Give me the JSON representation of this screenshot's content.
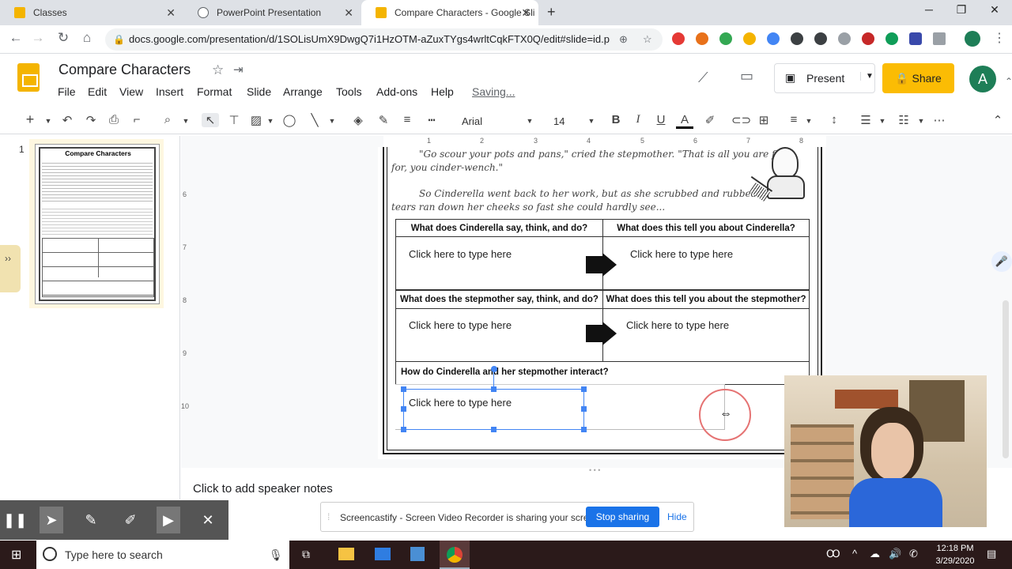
{
  "browser": {
    "tabs": [
      {
        "label": "Classes",
        "color": "#f4b400"
      },
      {
        "label": "PowerPoint Presentation",
        "color": "#5f6368"
      },
      {
        "label": "Compare Characters - Google Sli",
        "color": "#f4b400"
      }
    ],
    "url": "docs.google.com/presentation/d/1SOLisUmX9DwgQ7i1HzOTM-aZuxTYgs4wrltCqkFTX0Q/edit#slide=id.p"
  },
  "header": {
    "title": "Compare Characters",
    "menu": [
      "File",
      "Edit",
      "View",
      "Insert",
      "Format",
      "Slide",
      "Arrange",
      "Tools",
      "Add-ons",
      "Help"
    ],
    "status": "Saving...",
    "present_label": "Present",
    "share_label": "Share",
    "avatar_letter": "A",
    "accent_color": "#fbbc04"
  },
  "toolbar": {
    "font": "Arial",
    "font_size": "14"
  },
  "filmstrip": {
    "slide_number": "1",
    "thumb_title": "Compare Characters"
  },
  "slide": {
    "story_line1": "\"Go scour your pots and pans,\" cried the stepmother. \"That is all you are fit",
    "story_line2": "for, you cinder-wench.\"",
    "story_line3": "So Cinderella went back to her work, but as she scrubbed and rubbed the",
    "story_line4": "tears ran down her cheeks so fast she could hardly see...",
    "q1_left": "What does Cinderella say, think, and do?",
    "q1_right": "What does this tell you about Cinderella?",
    "q2_left": "What does the stepmother say, think, and do?",
    "q2_right": "What does this tell you about the stepmother?",
    "q3": "How do Cinderella and her stepmother interact?",
    "placeholder": "Click here to type here"
  },
  "ruler": [
    "1",
    "2",
    "3",
    "4",
    "5",
    "6",
    "7",
    "8"
  ],
  "vruler": [
    "6",
    "7",
    "8",
    "9",
    "10"
  ],
  "notes": "Click to add speaker notes",
  "screencastify": {
    "notice": "Screencastify - Screen Video Recorder is sharing your screen.",
    "stop_label": "Stop sharing",
    "hide_label": "Hide"
  },
  "taskbar": {
    "search_placeholder": "Type here to search",
    "time": "12:18 PM",
    "date": "3/29/2020"
  }
}
